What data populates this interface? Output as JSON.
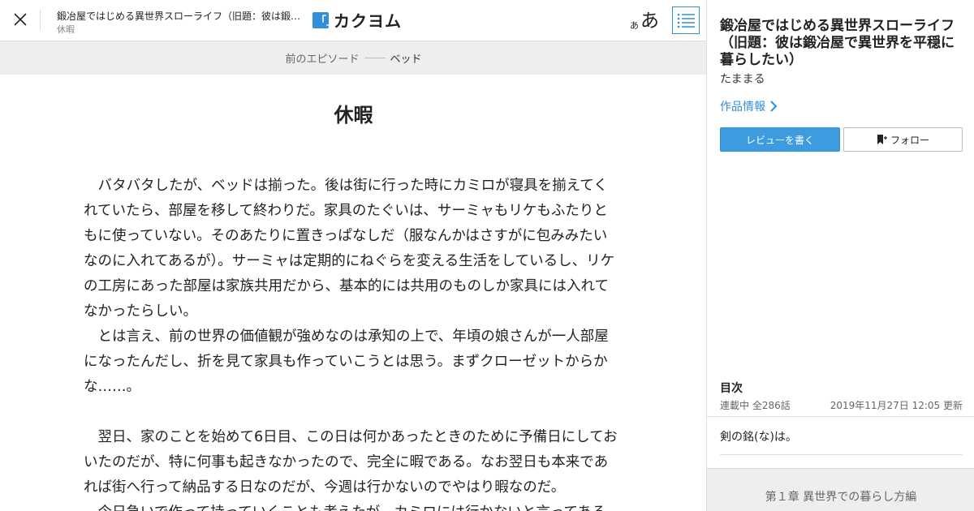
{
  "header": {
    "work_title": "鍛冶屋ではじめる異世界スローライフ（旧題：彼は鍛冶屋で異世界を平穏に暮らしたい）",
    "episode_title": "休暇",
    "logo_mark": "「」",
    "logo_text": "カクヨム",
    "font_small": "あ",
    "font_big": "あ",
    "close_icon": "close-icon",
    "toc_icon": "list-icon"
  },
  "prevbar": {
    "label": "前のエピソード",
    "episode": "ベッド"
  },
  "episode": {
    "title": "休暇",
    "paragraphs": [
      "　バタバタしたが、ベッドは揃った。後は街に行った時にカミロが寝具を揃えてくれていたら、部屋を移して終わりだ。家具のたぐいは、サーミャもリケもふたりともに使っていない。そのあたりに置きっぱなしだ（服なんかはさすがに包みみたいなのに入れてあるが）。サーミャは定期的にねぐらを変える生活をしているし、リケの工房にあった部屋は家族共用だから、基本的には共用のものしか家具には入れてなかったらしい。",
      "　とは言え、前の世界の価値観が強めなのは承知の上で、年頃の娘さんが一人部屋になったんだし、折を見て家具も作っていこうとは思う。まずクローゼットからかな……。",
      "",
      "　翌日、家のことを始めて6日目、この日は何かあったときのために予備日にしておいたのだが、特に何事も起きなかったので、完全に暇である。なお翌日も本来であれば街へ行って納品する日なのだが、今週は行かないのでやはり暇なのだ。",
      "　今日急いで作って持っていくことも考えたが、カミロには行かないと言ってある"
    ]
  },
  "sidebar": {
    "title": "鍛冶屋ではじめる異世界スローライフ（旧題：彼は鍛冶屋で異世界を平穏に暮らしたい）",
    "author": "たままる",
    "info_link": "作品情報",
    "review_button": "レビューを書く",
    "follow_button": "フォロー",
    "toc_heading": "目次",
    "status": "連載中 全286話",
    "updated": "2019年11月27日 12:05 更新",
    "toc_items": [
      "剣の銘(な)は。"
    ],
    "chapter": "第１章 異世界での暮らし方編"
  },
  "colors": {
    "accent": "#2f8fd8",
    "button_fill": "#3d9be0",
    "bar_gray": "#eeeeee"
  }
}
